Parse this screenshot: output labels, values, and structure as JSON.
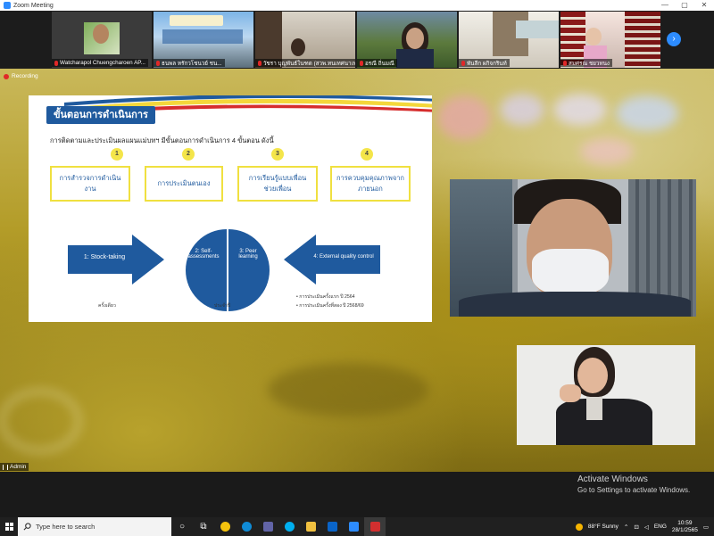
{
  "window": {
    "title": "Zoom Meeting",
    "controls": [
      "—",
      "▢",
      "✕"
    ]
  },
  "thumbnails": [
    {
      "name": "Watcharapol Chuengcharoen AP..."
    },
    {
      "name": "ธนพล หรักวโชนวย์ ชน..."
    },
    {
      "name": "วัชรา บุญพันธ์ในฑด (สวพ.ทนเทศนาเพช)"
    },
    {
      "name": "อรณี ถิ่นมณี"
    },
    {
      "name": "พันลีก ผกิจกรินท์"
    },
    {
      "name": "สมศรณ ชยวทนง"
    }
  ],
  "recording": {
    "label": "Recording"
  },
  "slide": {
    "title": "ขั้นตอนการดำเนินการ",
    "subtitle": "การติดตามและประเมินผลแผนแม่บทฯ มีขั้นตอนการดำเนินการ 4 ขั้นตอน ดังนี้",
    "steps": [
      {
        "num": "1",
        "text": "การสำรวจการดำเนินงาน"
      },
      {
        "num": "2",
        "text": "การประเมินตนเอง"
      },
      {
        "num": "3",
        "text": "การเรียนรู้แบบเพื่อนช่วยเพื่อน"
      },
      {
        "num": "4",
        "text": "การควบคุมคุณภาพจากภายนอก"
      }
    ],
    "arrows": [
      "1: Stock-taking",
      "2: Self-assessments",
      "3: Peer learning",
      "4: External quality control"
    ],
    "footnotes": [
      "ครั้งเดียว",
      "ประจำปี",
      "การประเมินครั้งแรก ปี 2564",
      "การประเมินครั้งที่สอง ปี 2568/69"
    ]
  },
  "admin": {
    "label": "Admin"
  },
  "watermark": {
    "line1": "Activate Windows",
    "line2": "Go to Settings to activate Windows."
  },
  "taskbar": {
    "search_placeholder": "Type here to search",
    "weather": "88°F  Sunny",
    "language": "ENG",
    "time": "10:59",
    "date": "28/1/2565",
    "icon_colors": {
      "chrome": "#f4c20d",
      "edge": "#0f8bd6",
      "teams": "#6264a7",
      "skype": "#00aff0",
      "explorer": "#f0c040",
      "mail": "#0a64c8",
      "zoom": "#2d8cff",
      "app": "#d32f2f"
    }
  }
}
